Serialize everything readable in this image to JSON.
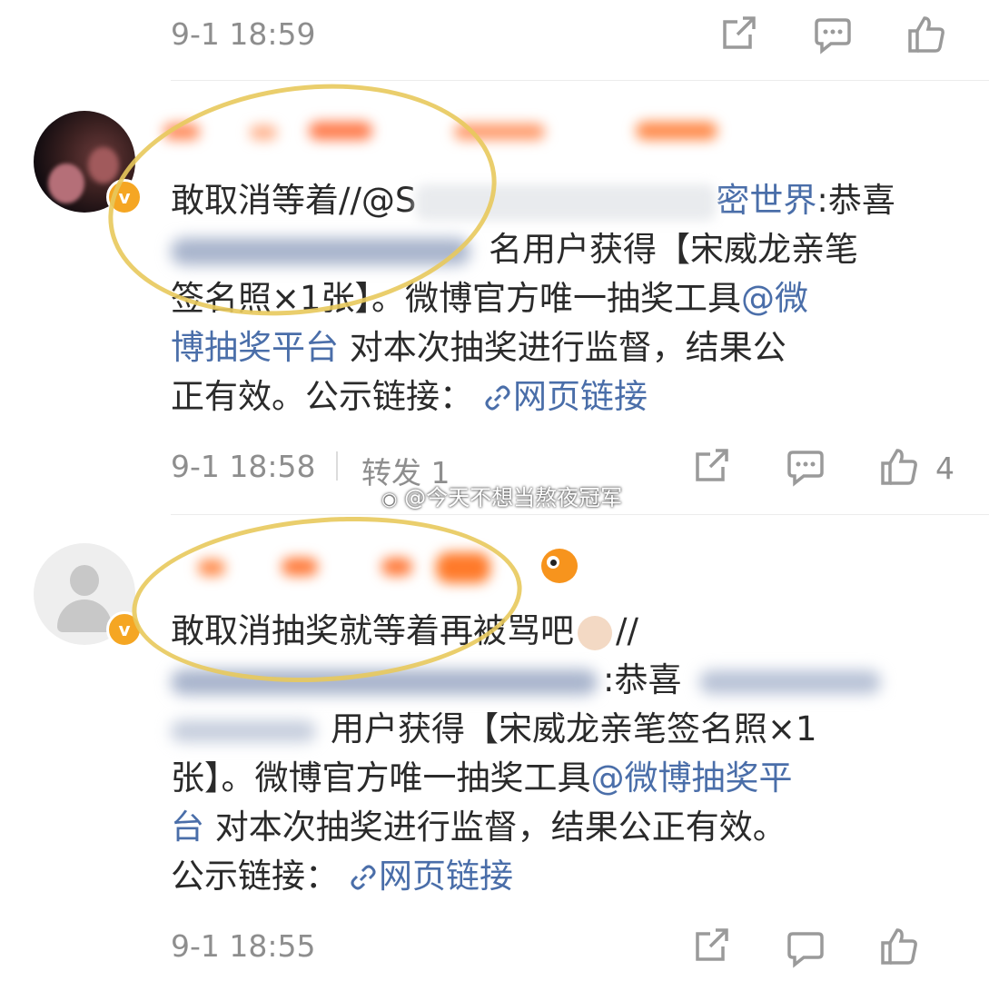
{
  "posts": [
    {
      "time": "9-1 18:59"
    },
    {
      "time": "9-1 18:58",
      "forward_label": "转发 1",
      "like_count": "4",
      "line1_prefix": "敢取消等着//@S",
      "line1_mention_tail": "密世界",
      "line1_suffix": ":恭喜",
      "line2": "名用户获得【宋威龙亲笔",
      "line3_text": "签名照×1张】。微博官方唯一抽奖工具",
      "line3_mention": "@微",
      "line4_mention": "博抽奖平台",
      "line4_text": " 对本次抽奖进行监督，结果公",
      "line5_text": "正有效。公示链接：",
      "link_label": "网页链接"
    },
    {
      "time": "9-1 18:55",
      "line1": "敢取消抽奖就等着再被骂吧",
      "line1_tail": "//",
      "line2": ":恭喜",
      "line3": "用户获得【宋威龙亲笔签名照×1",
      "line4_text": "张】。微博官方唯一抽奖工具",
      "line4_mention": "@微博抽奖平",
      "line5_mention": "台",
      "line5_text": " 对本次抽奖进行监督，结果公正有效。",
      "line6_text": "公示链接：",
      "link_label": "网页链接"
    }
  ],
  "watermark": "@今天不想当熬夜冠军",
  "colors": {
    "link": "#4a6ea9",
    "verified": "#f5a623",
    "annotation": "#e8c95c"
  }
}
